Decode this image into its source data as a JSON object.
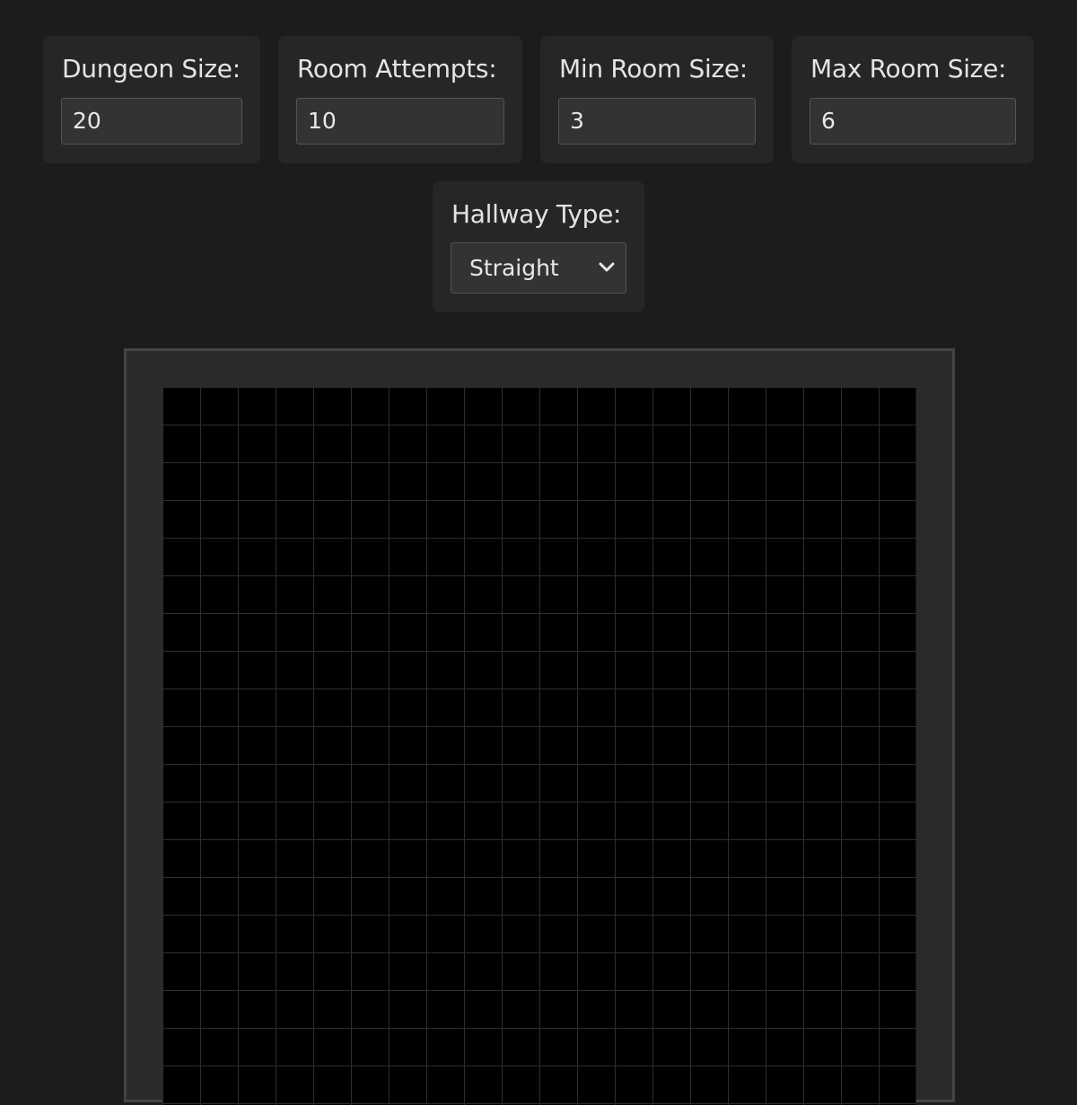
{
  "controls": {
    "dungeon_size": {
      "label": "Dungeon Size:",
      "value": "20"
    },
    "room_attempts": {
      "label": "Room Attempts:",
      "value": "10"
    },
    "min_room_size": {
      "label": "Min Room Size:",
      "value": "3"
    },
    "max_room_size": {
      "label": "Max Room Size:",
      "value": "6"
    },
    "hallway_type": {
      "label": "Hallway Type:",
      "selected": "Straight",
      "icon": "chevron-down-icon"
    }
  },
  "board": {
    "grid_columns": 20,
    "cell_color": "#000000",
    "grid_line_color": "#2e2e2e"
  },
  "colors": {
    "background": "#1c1c1c",
    "panel": "#262626",
    "input": "#333333",
    "frame": "#2a2a2a"
  }
}
